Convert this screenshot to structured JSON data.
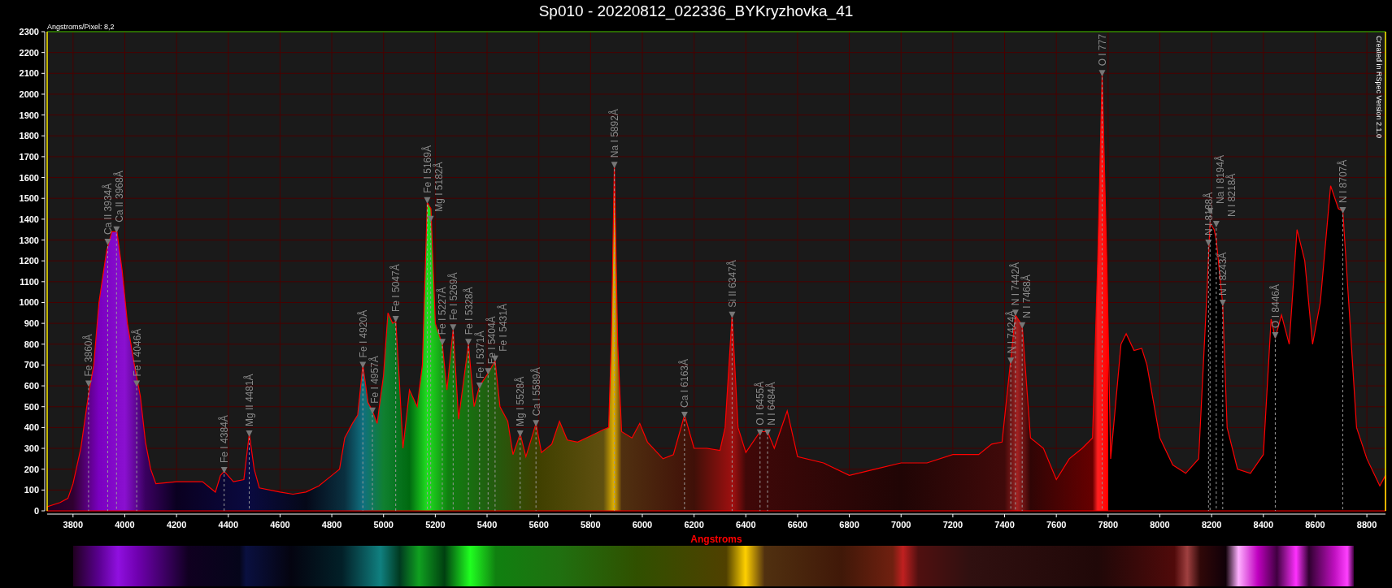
{
  "title": "Sp010 - 20220812_022336_BYKryzhovka_41",
  "scale_note": "Angstroms/Pixel: 8,2",
  "credit": "Created in RSpec Version 2.1.0",
  "chart_data": {
    "type": "area",
    "grid": true,
    "xlabel": "Angstroms",
    "xlim": [
      3700,
      8872
    ],
    "ylim": [
      0,
      2300
    ],
    "xticks": [
      3800,
      4000,
      4200,
      4400,
      4600,
      4800,
      5000,
      5200,
      5400,
      5600,
      5800,
      6000,
      6200,
      6400,
      6600,
      6800,
      7000,
      7200,
      7400,
      7600,
      7800,
      8000,
      8200,
      8400,
      8600,
      8800
    ],
    "yticks": [
      0,
      100,
      200,
      300,
      400,
      500,
      600,
      700,
      800,
      900,
      1000,
      1100,
      1200,
      1300,
      1400,
      1500,
      1600,
      1700,
      1800,
      1900,
      2000,
      2100,
      2200,
      2300
    ],
    "x": [
      3700,
      3750,
      3780,
      3800,
      3830,
      3860,
      3880,
      3900,
      3930,
      3950,
      3970,
      3990,
      4010,
      4040,
      4060,
      4080,
      4100,
      4120,
      4200,
      4300,
      4350,
      4370,
      4384,
      4420,
      4460,
      4481,
      4500,
      4520,
      4600,
      4650,
      4700,
      4750,
      4800,
      4830,
      4850,
      4880,
      4900,
      4920,
      4940,
      4957,
      4975,
      5000,
      5017,
      5035,
      5047,
      5060,
      5075,
      5100,
      5130,
      5150,
      5169,
      5183,
      5200,
      5227,
      5245,
      5269,
      5290,
      5328,
      5350,
      5371,
      5404,
      5431,
      5450,
      5480,
      5500,
      5528,
      5550,
      5589,
      5610,
      5650,
      5680,
      5710,
      5750,
      5800,
      5850,
      5870,
      5880,
      5892,
      5905,
      5920,
      5960,
      5990,
      6020,
      6080,
      6120,
      6163,
      6200,
      6250,
      6300,
      6320,
      6347,
      6370,
      6400,
      6455,
      6484,
      6510,
      6560,
      6600,
      6700,
      6800,
      6900,
      7000,
      7100,
      7200,
      7300,
      7350,
      7390,
      7424,
      7442,
      7468,
      7500,
      7550,
      7600,
      7650,
      7700,
      7740,
      7760,
      7777,
      7795,
      7810,
      7850,
      7870,
      7900,
      7930,
      7950,
      8000,
      8050,
      8100,
      8150,
      8180,
      8194,
      8210,
      8218,
      8243,
      8260,
      8300,
      8350,
      8400,
      8430,
      8446,
      8470,
      8500,
      8530,
      8560,
      8590,
      8620,
      8660,
      8690,
      8707,
      8730,
      8760,
      8800,
      8850,
      8872
    ],
    "series": [
      {
        "color": "#ff0000",
        "values": [
          20,
          40,
          60,
          130,
          300,
          560,
          700,
          1000,
          1250,
          1340,
          1340,
          1150,
          900,
          680,
          550,
          330,
          200,
          130,
          140,
          140,
          90,
          170,
          190,
          140,
          150,
          370,
          200,
          110,
          90,
          80,
          90,
          120,
          170,
          200,
          350,
          420,
          460,
          700,
          520,
          480,
          420,
          650,
          950,
          900,
          910,
          650,
          300,
          580,
          500,
          700,
          1480,
          1450,
          900,
          800,
          580,
          870,
          440,
          800,
          500,
          600,
          660,
          720,
          500,
          430,
          270,
          370,
          260,
          420,
          280,
          320,
          430,
          340,
          330,
          360,
          390,
          400,
          800,
          1660,
          800,
          380,
          350,
          420,
          330,
          250,
          270,
          460,
          300,
          300,
          290,
          400,
          940,
          400,
          280,
          380,
          380,
          300,
          480,
          260,
          230,
          170,
          200,
          230,
          230,
          270,
          270,
          320,
          330,
          730,
          940,
          890,
          350,
          300,
          150,
          250,
          300,
          350,
          1200,
          2100,
          1200,
          250,
          800,
          850,
          770,
          780,
          700,
          350,
          220,
          180,
          250,
          1000,
          1380,
          1350,
          1300,
          990,
          400,
          200,
          180,
          270,
          920,
          830,
          940,
          800,
          1350,
          1200,
          800,
          1000,
          1560,
          1450,
          1440,
          1000,
          400,
          250,
          120,
          170
        ]
      }
    ],
    "annotations": [
      {
        "x": 3860,
        "y": 610,
        "text": "Fe 3860Å"
      },
      {
        "x": 3934,
        "y": 1290,
        "text": "Ca II 3934Å"
      },
      {
        "x": 3968,
        "y": 1350,
        "text": "Ca II 3968Å"
      },
      {
        "x": 4046,
        "y": 610,
        "text": "Fe I 4046Å"
      },
      {
        "x": 4384,
        "y": 195,
        "text": "Fe I 4384Å"
      },
      {
        "x": 4481,
        "y": 370,
        "text": "Mg II 4481Å"
      },
      {
        "x": 4920,
        "y": 700,
        "text": "Fe I 4920Å"
      },
      {
        "x": 4957,
        "y": 480,
        "text": "Fe I 4957Å"
      },
      {
        "x": 5047,
        "y": 920,
        "text": "Fe I 5047Å"
      },
      {
        "x": 5169,
        "y": 1490,
        "text": "Fe I 5169Å"
      },
      {
        "x": 5182,
        "y": 1400,
        "text": "Mg I 5182Å"
      },
      {
        "x": 5227,
        "y": 810,
        "text": "Fe I 5227Å"
      },
      {
        "x": 5269,
        "y": 880,
        "text": "Fe I 5269Å"
      },
      {
        "x": 5328,
        "y": 810,
        "text": "Fe I 5328Å"
      },
      {
        "x": 5371,
        "y": 600,
        "text": "Fe I 5371Å"
      },
      {
        "x": 5404,
        "y": 670,
        "text": "Fe I 5404Å"
      },
      {
        "x": 5431,
        "y": 730,
        "text": "Fe I 5431Å"
      },
      {
        "x": 5528,
        "y": 370,
        "text": "Mg I 5528Å"
      },
      {
        "x": 5589,
        "y": 420,
        "text": "Ca I 5589Å"
      },
      {
        "x": 5892,
        "y": 1660,
        "text": "Na I 5892Å"
      },
      {
        "x": 6163,
        "y": 460,
        "text": "Ca I 6163Å"
      },
      {
        "x": 6347,
        "y": 940,
        "text": "Si II 6347Å"
      },
      {
        "x": 6455,
        "y": 375,
        "text": "O I 6455Å"
      },
      {
        "x": 6484,
        "y": 375,
        "text": "N I 6484Å"
      },
      {
        "x": 7424,
        "y": 720,
        "text": "N I 7424Å"
      },
      {
        "x": 7442,
        "y": 950,
        "text": "N I 7442Å"
      },
      {
        "x": 7468,
        "y": 890,
        "text": "N I 7468Å"
      },
      {
        "x": 7777,
        "y": 2100,
        "text": "O I 777"
      },
      {
        "x": 8188,
        "y": 1286,
        "text": "N I 8188Å"
      },
      {
        "x": 8194,
        "y": 1438,
        "text": "Na I 8194Å"
      },
      {
        "x": 8218,
        "y": 1376,
        "text": "N I 8218Å"
      },
      {
        "x": 8243,
        "y": 998,
        "text": "N I 8243Å"
      },
      {
        "x": 8446,
        "y": 842,
        "text": "O I 8446Å"
      },
      {
        "x": 8707,
        "y": 1442,
        "text": "N I 8707Å"
      }
    ]
  }
}
